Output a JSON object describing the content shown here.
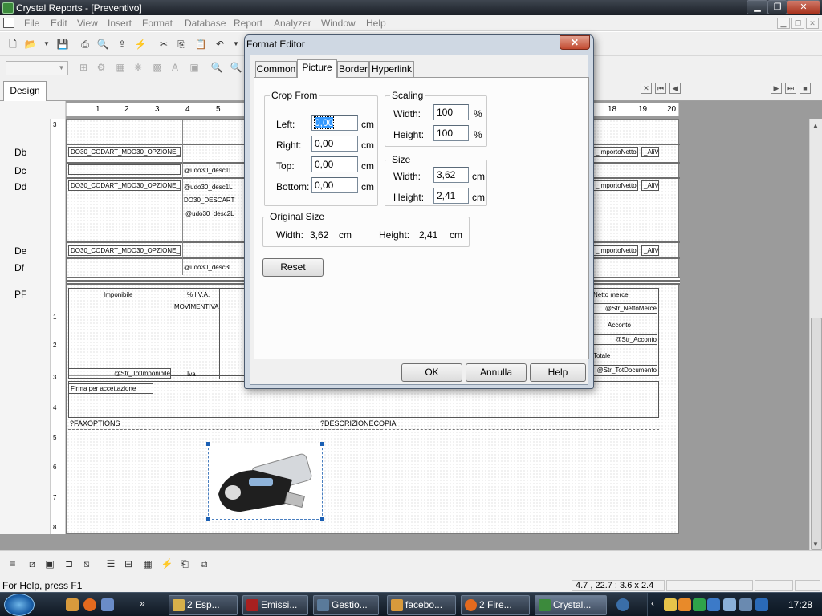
{
  "window": {
    "title": "Crystal Reports - [Preventivo]"
  },
  "menu": [
    "File",
    "Edit",
    "View",
    "Insert",
    "Format",
    "Database",
    "Report",
    "Analyzer",
    "Window",
    "Help"
  ],
  "tabs": {
    "design": "Design"
  },
  "ruler": {
    "h": [
      "1",
      "2",
      "3",
      "4",
      "5",
      "18",
      "19",
      "20"
    ],
    "v": [
      "3",
      "1",
      "1",
      "2",
      "3",
      "4",
      "5",
      "6",
      "7",
      "8"
    ]
  },
  "sections": [
    "Db",
    "Dc",
    "Dd",
    "De",
    "Df",
    "PF"
  ],
  "report": {
    "db_f1": "DO30_CODART_MDO30_OPZIONE_",
    "dc_f1": "@udo30_desc1L",
    "dd_f1": "DO30_CODART_MDO30_OPZIONE_",
    "dd_f2": "@udo30_desc1L",
    "dd_f3": "DO30_DESCART",
    "dd_f4": "@udo30_desc2L",
    "de_f1": "DO30_CODART_MDO30_OPZIONE_",
    "df_f1": "@udo30_desc3L",
    "r_importo": "_ImportoNetto",
    "r_aliv": "_AliV",
    "pf_imponibile": "Imponibile",
    "pf_aliva": "% I.V.A.",
    "pf_movimentiva": "MOVIMENTIVA",
    "pf_tot_imponibile": "@Str_TotImponibile",
    "pf_iva": "Iva",
    "pf_firma": "Firma per accettazione",
    "pf_faxoptions": "?FAXOPTIONS",
    "pf_descrizione": "?DESCRIZIONECOPIA",
    "pf_netto_merce": "Netto merce",
    "pf_str_netto": "@Str_NettoMerce",
    "pf_acconto": "Acconto",
    "pf_str_acconto": "@Str_Acconto",
    "pf_totale": "Totale",
    "pf_str_tot": "@Str_TotDocumento"
  },
  "dialog": {
    "title": "Format Editor",
    "close": "✕",
    "tabs": [
      "Common",
      "Picture",
      "Border",
      "Hyperlink"
    ],
    "crop": {
      "legend": "Crop From",
      "left_label": "Left:",
      "left": "0,00",
      "right_label": "Right:",
      "right": "0,00",
      "top_label": "Top:",
      "top": "0,00",
      "bottom_label": "Bottom:",
      "bottom": "0,00",
      "unit": "cm"
    },
    "scaling": {
      "legend": "Scaling",
      "width_label": "Width:",
      "width": "100",
      "height_label": "Height:",
      "height": "100",
      "unit": "%"
    },
    "size": {
      "legend": "Size",
      "width_label": "Width:",
      "width": "3,62",
      "height_label": "Height:",
      "height": "2,41",
      "unit": "cm"
    },
    "original": {
      "legend": "Original Size",
      "width_label": "Width:",
      "width": "3,62",
      "height_label": "Height:",
      "height": "2,41",
      "unit": "cm"
    },
    "reset": "Reset",
    "ok": "OK",
    "cancel": "Annulla",
    "help": "Help"
  },
  "status": {
    "help": "For Help, press F1",
    "coords": "4.7 , 22.7 : 3.6 x 2.4"
  },
  "taskbar": {
    "items": [
      "2 Esp...",
      "Emissi...",
      "Gestio...",
      "facebo...",
      "2 Fire...",
      "Crystal..."
    ],
    "clock": "17:28"
  },
  "colors": {
    "selection": "#3399ff",
    "taskbar": "#0f1822",
    "close": "#c24a30"
  }
}
